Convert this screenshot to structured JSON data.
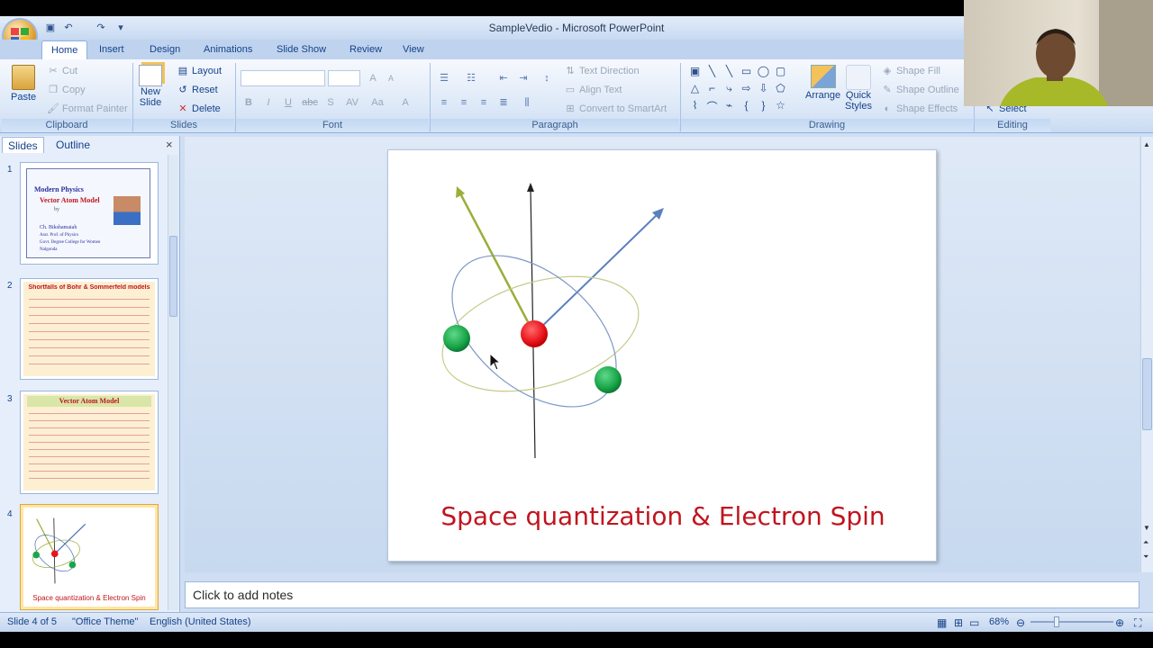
{
  "window": {
    "title": "SampleVedio - Microsoft PowerPoint"
  },
  "qat": {
    "save_icon": "save-icon",
    "undo_icon": "undo-icon",
    "redo_icon": "redo-icon",
    "customize_icon": "chevron-down-icon"
  },
  "tabs": [
    "Home",
    "Insert",
    "Design",
    "Animations",
    "Slide Show",
    "Review",
    "View"
  ],
  "ribbon": {
    "clipboard": {
      "label": "Clipboard",
      "paste": "Paste",
      "cut": "Cut",
      "copy": "Copy",
      "format_painter": "Format Painter"
    },
    "slides": {
      "label": "Slides",
      "new_slide": "New",
      "new_slide2": "Slide",
      "layout": "Layout",
      "reset": "Reset",
      "delete": "Delete"
    },
    "font": {
      "label": "Font",
      "bold": "B",
      "italic": "I",
      "underline": "U",
      "strike": "abc",
      "shadow": "S",
      "spacing": "AV",
      "case": "Aa",
      "color": "A",
      "grow": "A",
      "shrink": "A"
    },
    "paragraph": {
      "label": "Paragraph",
      "text_direction": "Text Direction",
      "align_text": "Align Text",
      "convert": "Convert to SmartArt"
    },
    "drawing": {
      "label": "Drawing",
      "arrange": "Arrange",
      "quick_styles": "Quick",
      "quick_styles2": "Styles",
      "shape_fill": "Shape Fill",
      "shape_outline": "Shape Outline",
      "shape_effects": "Shape Effects"
    },
    "editing": {
      "label": "Editing",
      "select": "Select"
    }
  },
  "panel": {
    "tab_slides": "Slides",
    "tab_outline": "Outline",
    "close": "×"
  },
  "thumbs": [
    {
      "num": "1",
      "title": "Modern Physics",
      "title2": "Vector Atom Model",
      "by": "by",
      "author": "Ch. Bikshamaiah",
      "pos": "Asst. Prof. of Physics",
      "college": "Govt. Degree College for Women",
      "place": "Nalgonda"
    },
    {
      "num": "2",
      "title": "Shortfalls of Bohr & Sommerfeld models"
    },
    {
      "num": "3",
      "title": "Vector Atom Model"
    },
    {
      "num": "4",
      "caption": "Space quantization & Electron Spin"
    }
  ],
  "slide": {
    "title": "Space quantization & Electron Spin"
  },
  "notes": {
    "placeholder": "Click to add notes"
  },
  "status": {
    "slide": "Slide 4 of 5",
    "theme": "\"Office Theme\"",
    "language": "English (United States)",
    "zoom": "68%"
  },
  "colors": {
    "accent": "#15428b",
    "title_red": "#c0151f",
    "nucleus": "#e8141c",
    "electron": "#1aa64a"
  }
}
